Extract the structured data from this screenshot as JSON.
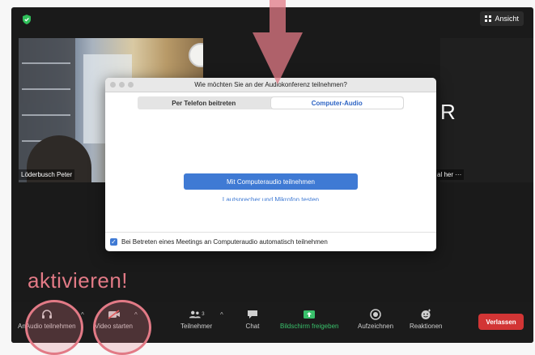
{
  "window": {
    "view_button_label": "Ansicht"
  },
  "tiles": [
    {
      "name": "Löderbusch Peter"
    },
    {
      "initial": "R",
      "name_partial": "al her"
    }
  ],
  "modal": {
    "title": "Wie möchten Sie an der Audiokonferenz teilnehmen?",
    "tabs": [
      {
        "label": "Per Telefon beitreten",
        "active": false
      },
      {
        "label": "Computer-Audio",
        "active": true
      }
    ],
    "join_button_label": "Mit Computeraudio teilnehmen",
    "test_link_label": "Lautsprecher und Mikrofon testen",
    "auto_join_checkbox_label": "Bei Betreten eines Meetings an Computeraudio automatisch teilnehmen",
    "auto_join_checked": true
  },
  "toolbar": {
    "audio_label": "Audio teilnehmen",
    "audio_label_prefix": "An",
    "video_label": "Video starten",
    "participants_label": "Teilnehmer",
    "participants_count": "3",
    "chat_label": "Chat",
    "share_label": "Bildschirm freigeben",
    "record_label": "Aufzeichnen",
    "reactions_label": "Reaktionen",
    "leave_label": "Verlassen"
  },
  "annotation": {
    "text": "aktivieren!"
  },
  "colors": {
    "accent_blue": "#3f7ad4",
    "leave_red": "#d23535",
    "annotation_pink": "#e27a86",
    "share_green": "#39c06b",
    "security_green": "#2fbf5a"
  }
}
